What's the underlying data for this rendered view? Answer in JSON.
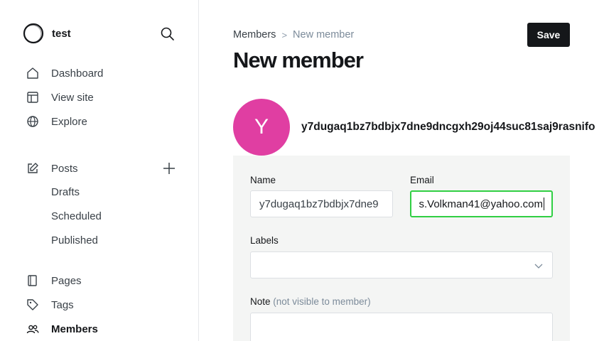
{
  "sidebar": {
    "site_name": "test",
    "nav": [
      {
        "label": "Dashboard",
        "icon": "home-icon"
      },
      {
        "label": "View site",
        "icon": "layout-icon"
      },
      {
        "label": "Explore",
        "icon": "globe-icon"
      }
    ],
    "posts": {
      "label": "Posts",
      "icon": "pencil-icon",
      "subitems": [
        "Drafts",
        "Scheduled",
        "Published"
      ]
    },
    "nav2": [
      {
        "label": "Pages",
        "icon": "page-icon"
      },
      {
        "label": "Tags",
        "icon": "tag-icon"
      },
      {
        "label": "Members",
        "icon": "members-icon"
      }
    ]
  },
  "header": {
    "breadcrumb_parent": "Members",
    "breadcrumb_separator": ">",
    "breadcrumb_current": "New member",
    "title": "New member",
    "save_label": "Save"
  },
  "member": {
    "avatar_letter": "Y",
    "avatar_color": "#e03ea2",
    "name_heading": "y7dugaq1bz7bdbjx7dne9dncgxh29oj44suc81saj9rasnifo"
  },
  "form": {
    "name_label": "Name",
    "name_value": "y7dugaq1bz7bdbjx7dne9",
    "email_label": "Email",
    "email_value": "s.Volkman41@yahoo.com",
    "labels_label": "Labels",
    "note_label": "Note",
    "note_hint": "(not visible to member)"
  },
  "colors": {
    "accent_focus": "#30cf43",
    "button_bg": "#15171a"
  }
}
